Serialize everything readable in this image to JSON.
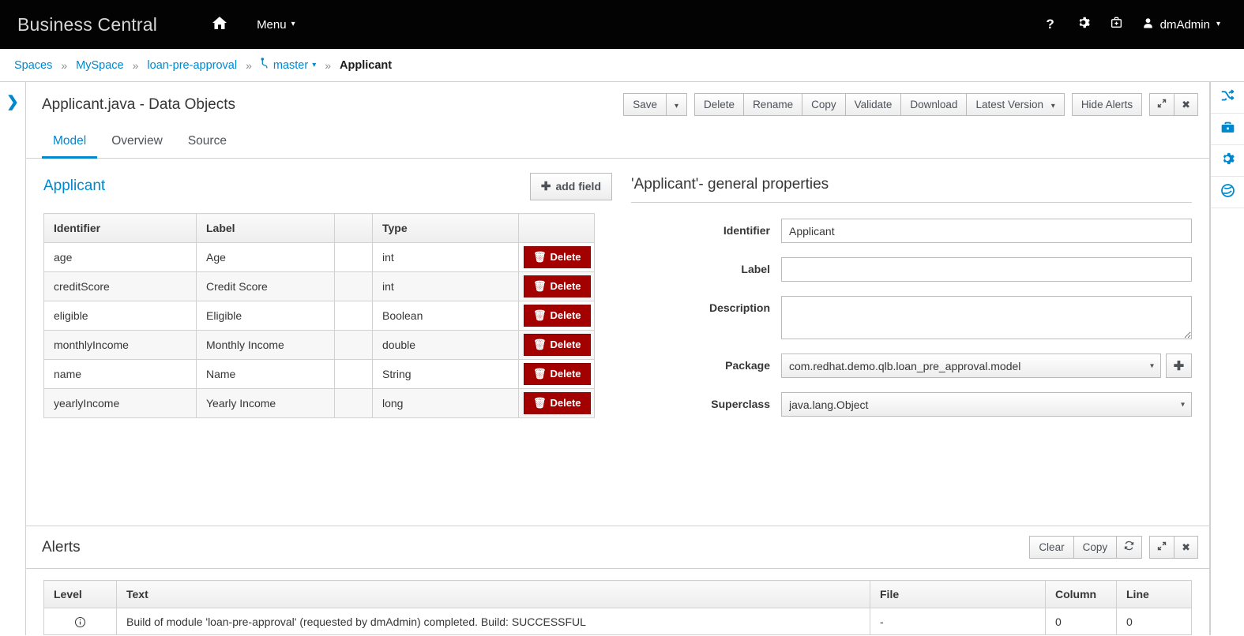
{
  "masthead": {
    "brand": "Business Central",
    "home_icon": "home-icon",
    "menu_label": "Menu",
    "help_icon": "question-mark-icon",
    "settings_icon": "gear-icon",
    "support_icon": "first-aid-kit-icon",
    "user_name": "dmAdmin",
    "background_color": "#030303"
  },
  "breadcrumb": {
    "items": [
      {
        "label": "Spaces",
        "type": "link"
      },
      {
        "label": "MySpace",
        "type": "link"
      },
      {
        "label": "loan-pre-approval",
        "type": "link"
      },
      {
        "label": "master",
        "type": "branch"
      },
      {
        "label": "Applicant",
        "type": "current"
      }
    ],
    "separator": "»",
    "link_color": "#0088ce"
  },
  "left_rail": {
    "toggle_icon": "chevron-right-icon"
  },
  "right_rail": {
    "items": [
      {
        "name": "shuffle-icon"
      },
      {
        "name": "briefcase-icon"
      },
      {
        "name": "gear-icon"
      },
      {
        "name": "globe-icon"
      }
    ],
    "icon_color": "#0088ce"
  },
  "editor": {
    "title": "Applicant.java - Data Objects",
    "toolbar": {
      "save_label": "Save",
      "save_caret": "⌄",
      "delete_label": "Delete",
      "rename_label": "Rename",
      "copy_label": "Copy",
      "validate_label": "Validate",
      "download_label": "Download",
      "version_label": "Latest Version",
      "hide_alerts_label": "Hide Alerts",
      "maximize_icon": "expand-icon",
      "close_icon": "close-icon"
    },
    "tabs": [
      {
        "label": "Model",
        "active": true
      },
      {
        "label": "Overview",
        "active": false
      },
      {
        "label": "Source",
        "active": false
      }
    ]
  },
  "data_model": {
    "name": "Applicant",
    "add_field_label": "add field",
    "add_field_icon": "plus-icon",
    "columns": [
      "Identifier",
      "Label",
      "",
      "Type",
      ""
    ],
    "delete_label": "Delete",
    "delete_icon": "trash-icon",
    "delete_color": "#a30000",
    "rows": [
      {
        "identifier": "age",
        "label": "Age",
        "type": "int"
      },
      {
        "identifier": "creditScore",
        "label": "Credit Score",
        "type": "int"
      },
      {
        "identifier": "eligible",
        "label": "Eligible",
        "type": "Boolean"
      },
      {
        "identifier": "monthlyIncome",
        "label": "Monthly Income",
        "type": "double"
      },
      {
        "identifier": "name",
        "label": "Name",
        "type": "String"
      },
      {
        "identifier": "yearlyIncome",
        "label": "Yearly Income",
        "type": "long"
      }
    ]
  },
  "general_properties": {
    "title": "'Applicant'- general properties",
    "identifier_label": "Identifier",
    "identifier_value": "Applicant",
    "label_label": "Label",
    "label_value": "",
    "description_label": "Description",
    "description_value": "",
    "package_label": "Package",
    "package_value": "com.redhat.demo.qlb.loan_pre_approval.model",
    "package_add_icon": "plus-icon",
    "superclass_label": "Superclass",
    "superclass_value": "java.lang.Object"
  },
  "alerts": {
    "title": "Alerts",
    "toolbar": {
      "clear_label": "Clear",
      "copy_label": "Copy",
      "refresh_icon": "refresh-icon",
      "maximize_icon": "expand-icon",
      "close_icon": "close-icon"
    },
    "columns": [
      "Level",
      "Text",
      "File",
      "Column",
      "Line"
    ],
    "rows": [
      {
        "level_icon": "info-circle-icon",
        "text": "Build of module 'loan-pre-approval' (requested by dmAdmin) completed. Build: SUCCESSFUL",
        "file": "-",
        "column": "0",
        "line": "0"
      }
    ]
  }
}
